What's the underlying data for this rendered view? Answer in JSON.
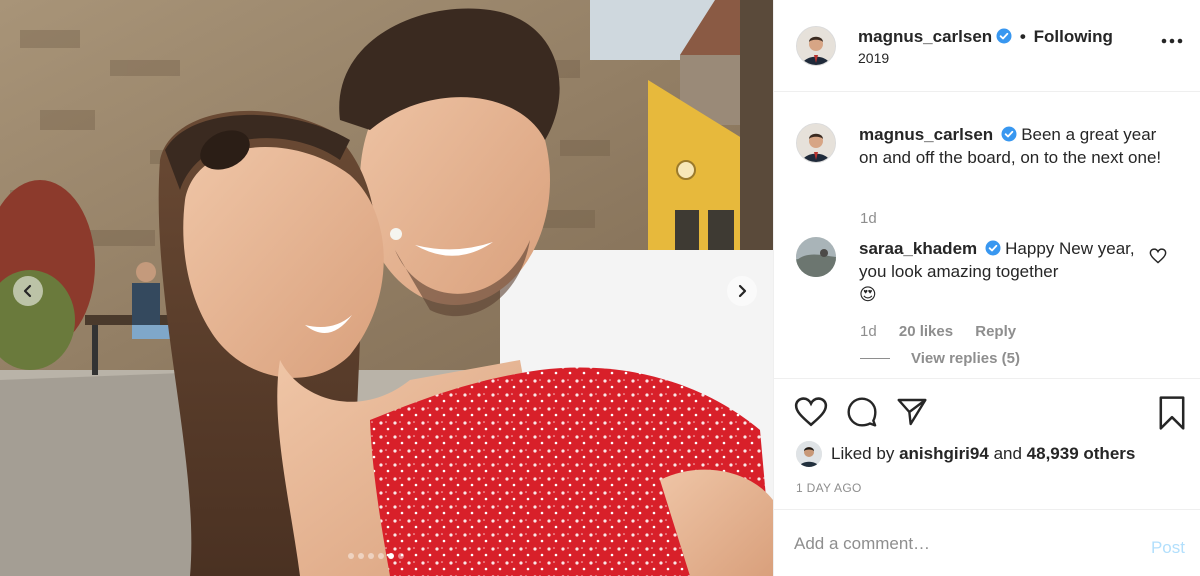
{
  "post": {
    "author": "magnus_carlsen",
    "follow_status": "Following",
    "separator": "•",
    "location": "2019",
    "more_icon": "more-horizontal-icon",
    "verified_color": "#3897f0"
  },
  "carousel": {
    "slide_count": 6,
    "active_index": 4,
    "prev_icon": "chevron-left-icon",
    "next_icon": "chevron-right-icon"
  },
  "caption": {
    "username": "magnus_carlsen",
    "text": "Been a great year on and off the board, on to the next one!",
    "time": "1d"
  },
  "comments": [
    {
      "username": "saraa_khadem",
      "text": "Happy New year, you look amazing together",
      "emoji": "😍",
      "time": "1d",
      "likes": "20 likes",
      "reply_label": "Reply",
      "view_replies": "View replies (5)"
    }
  ],
  "actions": {
    "icons": [
      "heart-icon",
      "comment-icon",
      "share-icon",
      "bookmark-icon"
    ]
  },
  "likes": {
    "prefix": "Liked by",
    "user": "anishgiri94",
    "middle": "and",
    "others": "48,939 others"
  },
  "timestamp": "1 DAY AGO",
  "add_comment": {
    "placeholder": "Add a comment…",
    "post_label": "Post",
    "post_color": "#b2dffc"
  }
}
